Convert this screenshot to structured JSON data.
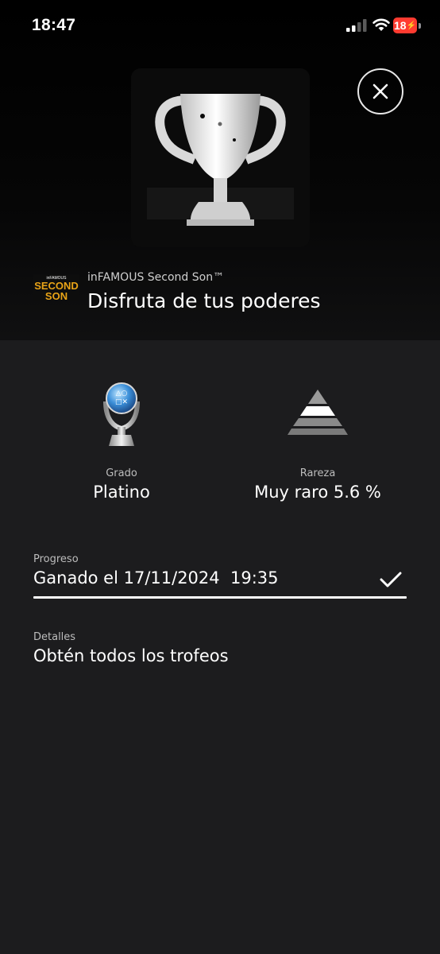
{
  "status_bar": {
    "time": "18:47",
    "battery": "18",
    "icons": [
      "signal-icon",
      "wifi-icon",
      "battery-low-charging-icon"
    ]
  },
  "header": {
    "game_title": "inFAMOUS Second Son™",
    "trophy_title": "Disfruta de tus poderes",
    "game_logo_icon": "infamous-second-son-logo",
    "trophy_image_icon": "silver-cup-trophy-art",
    "close_icon": "close-icon"
  },
  "stats": {
    "grade": {
      "label": "Grado",
      "value": "Platino",
      "icon": "platinum-trophy-icon"
    },
    "rarity": {
      "label": "Rareza",
      "value": "Muy raro 5.6 %",
      "icon": "rarity-pyramid-icon"
    }
  },
  "progress": {
    "label": "Progreso",
    "value": "Ganado el 17/11/2024  19:35",
    "completion": 1.0,
    "icon": "checkmark-icon"
  },
  "details": {
    "label": "Detalles",
    "value": "Obtén todos los trofeos"
  },
  "colors": {
    "background": "#1c1c1e",
    "header_background": "#000000",
    "battery_low": "#ff3b30",
    "platinum_blue": "#3b8fd9"
  }
}
